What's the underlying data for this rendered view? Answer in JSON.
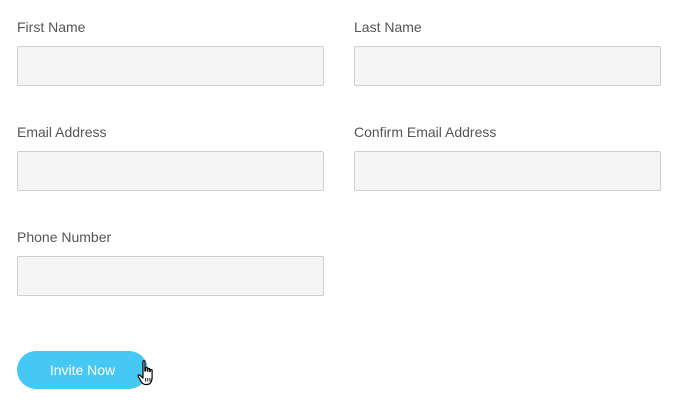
{
  "form": {
    "first_name": {
      "label": "First Name",
      "value": "",
      "placeholder": ""
    },
    "last_name": {
      "label": "Last Name",
      "value": "",
      "placeholder": ""
    },
    "email": {
      "label": "Email Address",
      "value": "",
      "placeholder": ""
    },
    "confirm_email": {
      "label": "Confirm Email Address",
      "value": "",
      "placeholder": ""
    },
    "phone": {
      "label": "Phone Number",
      "value": "",
      "placeholder": ""
    },
    "submit_label": "Invite Now"
  },
  "colors": {
    "accent": "#45c8f3",
    "input_background": "#f5f5f5",
    "input_border": "#cfcfcf",
    "label_text": "#555555"
  },
  "icons": {
    "cursor": "hand-pointer-icon"
  }
}
